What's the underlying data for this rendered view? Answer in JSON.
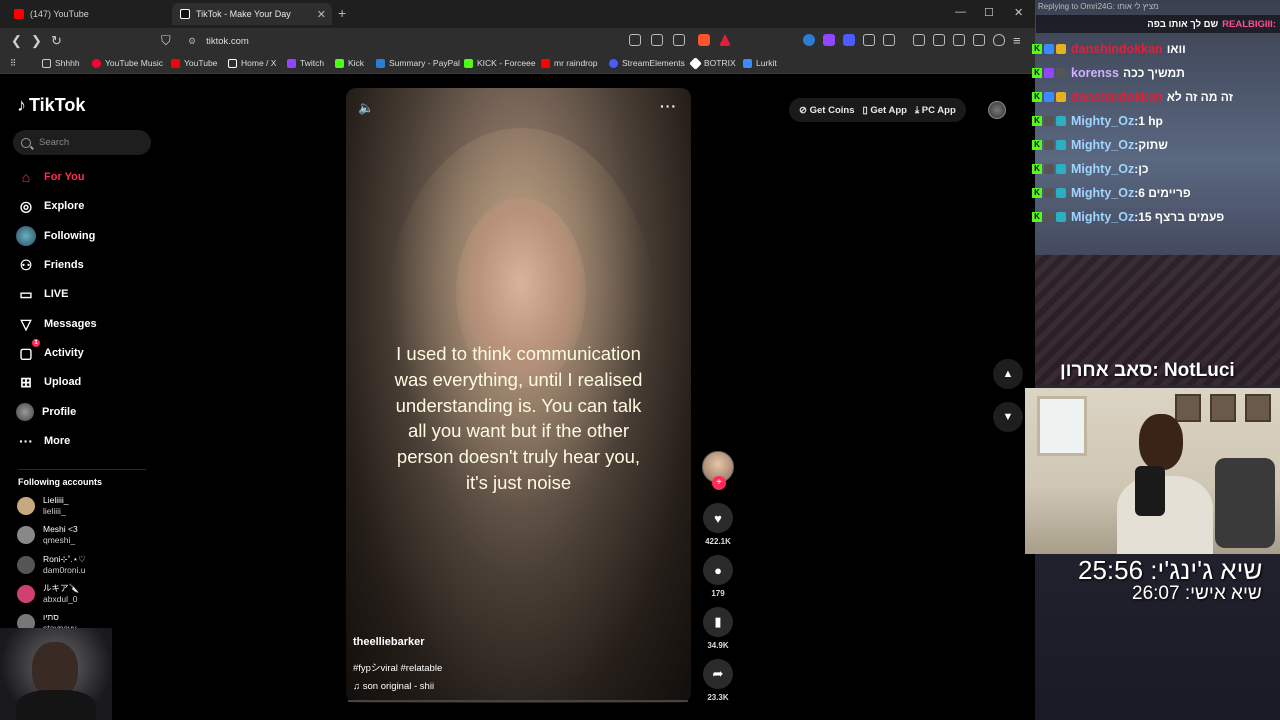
{
  "browser": {
    "tabs": [
      {
        "label": "(147) YouTube",
        "favicon_color": "#ff0000"
      },
      {
        "label": "TikTok - Make Your Day",
        "favicon_color": "#ffffff"
      }
    ],
    "new_tab": "+",
    "url": "tiktok.com",
    "bookmarks": [
      {
        "label": "Shhhh",
        "icon": "folder-icon",
        "color": "#cccccc"
      },
      {
        "label": "YouTube Music",
        "icon": "youtube-music-icon",
        "color": "#ff0033"
      },
      {
        "label": "YouTube",
        "icon": "youtube-icon",
        "color": "#ff0000"
      },
      {
        "label": "Home / X",
        "icon": "x-icon",
        "color": "#ffffff"
      },
      {
        "label": "Twitch",
        "icon": "twitch-icon",
        "color": "#9146ff"
      },
      {
        "label": "Kick",
        "icon": "kick-icon",
        "color": "#53fc18"
      },
      {
        "label": "Summary - PayPal",
        "icon": "paypal-icon",
        "color": "#2a7fd4"
      },
      {
        "label": "KICK - Forceee",
        "icon": "kick-icon",
        "color": "#53fc18"
      },
      {
        "label": "mr raindrop",
        "icon": "youtube-icon",
        "color": "#ff0000"
      },
      {
        "label": "StreamElements",
        "icon": "streamelements-icon",
        "color": "#4a5cff"
      },
      {
        "label": "BOTRIX",
        "icon": "botrix-icon",
        "color": "#ffffff"
      },
      {
        "label": "Lurkit",
        "icon": "lurkit-icon",
        "color": "#3a8bff"
      }
    ]
  },
  "tiktok": {
    "logo": "TikTok",
    "search_placeholder": "Search",
    "nav": [
      {
        "label": "For You",
        "icon": "home-icon",
        "active": true
      },
      {
        "label": "Explore",
        "icon": "compass-icon"
      },
      {
        "label": "Following",
        "icon": "following-avatar-icon"
      },
      {
        "label": "Friends",
        "icon": "friends-icon"
      },
      {
        "label": "LIVE",
        "icon": "live-icon"
      },
      {
        "label": "Messages",
        "icon": "messages-icon"
      },
      {
        "label": "Activity",
        "icon": "activity-icon",
        "badge": "1"
      },
      {
        "label": "Upload",
        "icon": "upload-icon"
      },
      {
        "label": "Profile",
        "icon": "profile-avatar-icon"
      },
      {
        "label": "More",
        "icon": "more-icon"
      }
    ],
    "following_title": "Following accounts",
    "following_accounts": [
      {
        "name": "Lieliiii_",
        "handle": "lieliiii_",
        "avatar_color": "#c8a880"
      },
      {
        "name": "Meshi <3",
        "handle": "qmeshi_",
        "avatar_color": "#888888"
      },
      {
        "name": "Roni⊹˚.⋆♡",
        "handle": "dam0roni.u",
        "avatar_color": "#555555"
      },
      {
        "name": "ルキア🔪",
        "handle": "abxdul_0",
        "avatar_color": "#d04070"
      },
      {
        "name": "סתיו",
        "handle": "stavnavy",
        "avatar_color": "#777777"
      }
    ],
    "top_buttons": {
      "coins": "Get Coins",
      "app": "Get App",
      "pc": "PC App"
    },
    "video": {
      "caption": "I used to think communication was everything, until I realised understanding is. You can talk all you want but if the other person doesn't truly hear you, it's just noise",
      "author": "theelliebarker",
      "tags": "#fypシviral #relatable",
      "sound": "son original - shii"
    },
    "actions": {
      "likes": "422.1K",
      "comments": "179",
      "saves": "34.9K",
      "shares": "23.3K"
    }
  },
  "overlay": {
    "reply_text": "Replying to Omri24G: מציץ לי אותו",
    "top_message_user": "REALBIGIII:",
    "top_message_text": "שם לך אותו בפה",
    "chat": [
      {
        "user": "danshindokkan",
        "color": "#e0203a",
        "message": "וואו"
      },
      {
        "user": "korenss",
        "color": "#d0b0ff",
        "message": "תמשיך ככה"
      },
      {
        "user": "danshindokkan",
        "color": "#e0203a",
        "message": "זה מה זה לא"
      },
      {
        "user": "Mighty_Oz",
        "color": "#9fd4ff",
        "message": "1 hp"
      },
      {
        "user": "Mighty_Oz",
        "color": "#9fd4ff",
        "message": "שתוק"
      },
      {
        "user": "Mighty_Oz",
        "color": "#9fd4ff",
        "message": "כן"
      },
      {
        "user": "Mighty_Oz",
        "color": "#9fd4ff",
        "message": "6 פריימים"
      },
      {
        "user": "Mighty_Oz",
        "color": "#9fd4ff",
        "message": "15 פעמים ברצף"
      }
    ],
    "last_sub": "סאב אחרון: NotLuci",
    "timer_main": "שיא ג'ינג'י: 25:56",
    "timer_personal": "שיא אישי: 26:07"
  },
  "colors": {
    "accent": "#fe2c55",
    "caption": "#fffbe0",
    "kick_green": "#53fc18"
  }
}
